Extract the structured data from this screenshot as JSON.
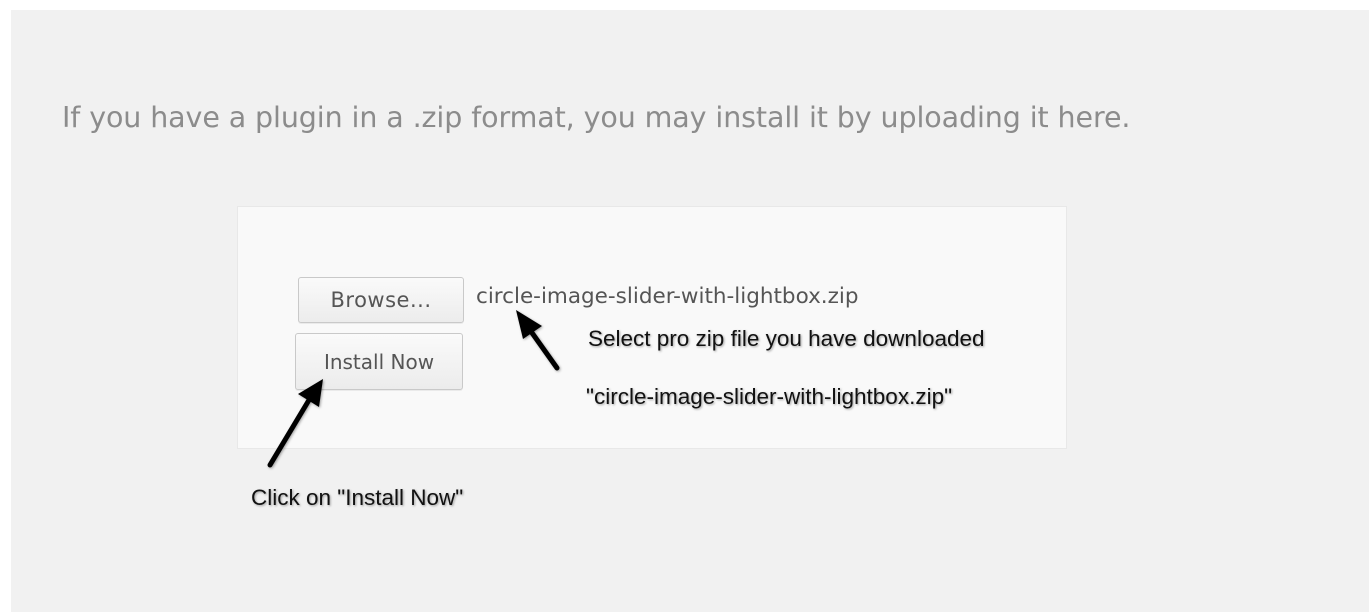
{
  "instructions": {
    "intro_text": "If you have a plugin in a .zip format, you may install it by uploading it here."
  },
  "upload_form": {
    "browse_label": "Browse...",
    "selected_file": "circle-image-slider-with-lightbox.zip",
    "install_label": "Install Now"
  },
  "annotations": {
    "select_note": "Select pro zip file you have downloaded",
    "filename_note": "\"circle-image-slider-with-lightbox.zip\"",
    "click_note": "Click on \"Install Now\""
  },
  "colors": {
    "page_background": "#f1f1f1",
    "box_background": "#f9f9f9",
    "intro_text": "#8c8c8c",
    "annotation_text": "#111111"
  },
  "icons": [
    "arrow-to-file-name-icon",
    "arrow-to-install-button-icon"
  ]
}
